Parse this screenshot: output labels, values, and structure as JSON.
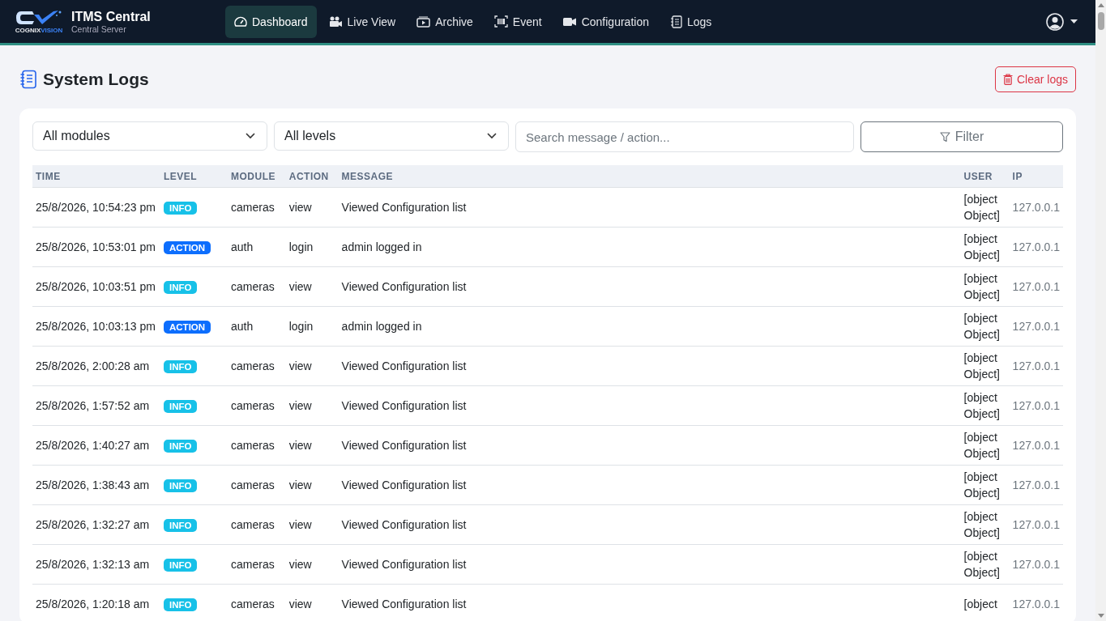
{
  "brand": {
    "title": "ITMS Central",
    "subtitle": "Central Server",
    "logo_text_1": "COGNIX",
    "logo_text_2": "VISION"
  },
  "nav": [
    {
      "label": "Dashboard",
      "selected": true
    },
    {
      "label": "Live View",
      "selected": false
    },
    {
      "label": "Archive",
      "selected": false
    },
    {
      "label": "Event",
      "selected": false
    },
    {
      "label": "Configuration",
      "selected": false
    },
    {
      "label": "Logs",
      "selected": false
    }
  ],
  "page": {
    "title": "System Logs",
    "clear_button": "Clear logs"
  },
  "filters": {
    "module": "All modules",
    "level": "All levels",
    "search_placeholder": "Search message / action...",
    "filter_button": "Filter"
  },
  "table": {
    "columns": [
      "TIME",
      "LEVEL",
      "MODULE",
      "ACTION",
      "MESSAGE",
      "USER",
      "IP"
    ],
    "rows": [
      {
        "time": "25/8/2026, 10:54:23 pm",
        "level": "INFO",
        "kind": "info",
        "module": "cameras",
        "action": "view",
        "message": "Viewed Configuration list",
        "user": "[object Object]",
        "ip": "127.0.0.1"
      },
      {
        "time": "25/8/2026, 10:53:01 pm",
        "level": "ACTION",
        "kind": "action",
        "module": "auth",
        "action": "login",
        "message": "admin logged in",
        "user": "[object Object]",
        "ip": "127.0.0.1"
      },
      {
        "time": "25/8/2026, 10:03:51 pm",
        "level": "INFO",
        "kind": "info",
        "module": "cameras",
        "action": "view",
        "message": "Viewed Configuration list",
        "user": "[object Object]",
        "ip": "127.0.0.1"
      },
      {
        "time": "25/8/2026, 10:03:13 pm",
        "level": "ACTION",
        "kind": "action",
        "module": "auth",
        "action": "login",
        "message": "admin logged in",
        "user": "[object Object]",
        "ip": "127.0.0.1"
      },
      {
        "time": "25/8/2026, 2:00:28 am",
        "level": "INFO",
        "kind": "info",
        "module": "cameras",
        "action": "view",
        "message": "Viewed Configuration list",
        "user": "[object Object]",
        "ip": "127.0.0.1"
      },
      {
        "time": "25/8/2026, 1:57:52 am",
        "level": "INFO",
        "kind": "info",
        "module": "cameras",
        "action": "view",
        "message": "Viewed Configuration list",
        "user": "[object Object]",
        "ip": "127.0.0.1"
      },
      {
        "time": "25/8/2026, 1:40:27 am",
        "level": "INFO",
        "kind": "info",
        "module": "cameras",
        "action": "view",
        "message": "Viewed Configuration list",
        "user": "[object Object]",
        "ip": "127.0.0.1"
      },
      {
        "time": "25/8/2026, 1:38:43 am",
        "level": "INFO",
        "kind": "info",
        "module": "cameras",
        "action": "view",
        "message": "Viewed Configuration list",
        "user": "[object Object]",
        "ip": "127.0.0.1"
      },
      {
        "time": "25/8/2026, 1:32:27 am",
        "level": "INFO",
        "kind": "info",
        "module": "cameras",
        "action": "view",
        "message": "Viewed Configuration list",
        "user": "[object Object]",
        "ip": "127.0.0.1"
      },
      {
        "time": "25/8/2026, 1:32:13 am",
        "level": "INFO",
        "kind": "info",
        "module": "cameras",
        "action": "view",
        "message": "Viewed Configuration list",
        "user": "[object Object]",
        "ip": "127.0.0.1"
      },
      {
        "time": "25/8/2026, 1:20:18 am",
        "level": "INFO",
        "kind": "info",
        "module": "cameras",
        "action": "view",
        "message": "Viewed Configuration list",
        "user": "[object",
        "ip": "127.0.0.1"
      }
    ]
  }
}
